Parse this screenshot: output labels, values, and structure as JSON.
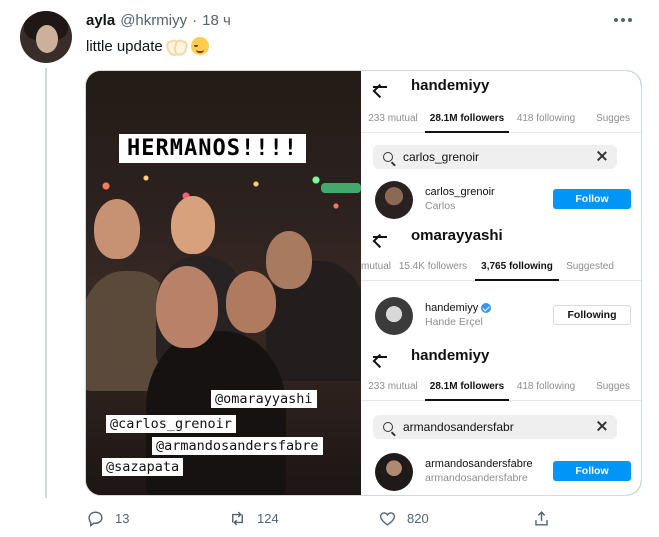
{
  "tweet": {
    "author_name": "ayla",
    "author_handle": "@hkrmiyy",
    "separator": "·",
    "time": "18 ч",
    "text": "little update",
    "emoji": [
      "open-hands-emoji",
      "relieved-face-emoji"
    ]
  },
  "story": {
    "caption": "HERMANOS!!!!",
    "tags": [
      "@omarayyashi",
      "@carlos_grenoir",
      "@armandosandersfabre",
      "@sazapata"
    ]
  },
  "panels": [
    {
      "title": "handemiyy",
      "tabs": [
        {
          "label": "233 mutual",
          "active": false
        },
        {
          "label": "28.1M followers",
          "active": true
        },
        {
          "label": "418 following",
          "active": false
        },
        {
          "label": "Sugges",
          "active": false
        }
      ],
      "search": "carlos_grenoir",
      "result": {
        "username": "carlos_grenoir",
        "name": "Carlos",
        "verified": false,
        "button": "Follow"
      }
    },
    {
      "title": "omarayyashi",
      "tabs": [
        {
          "label": "mutual",
          "active": false
        },
        {
          "label": "15.4K followers",
          "active": false
        },
        {
          "label": "3,765 following",
          "active": true
        },
        {
          "label": "Suggested",
          "active": false
        }
      ],
      "result": {
        "username": "handemiyy",
        "name": "Hande Erçel",
        "verified": true,
        "button": "Following"
      }
    },
    {
      "title": "handemiyy",
      "tabs": [
        {
          "label": "233 mutual",
          "active": false
        },
        {
          "label": "28.1M followers",
          "active": true
        },
        {
          "label": "418 following",
          "active": false
        },
        {
          "label": "Sugges",
          "active": false
        }
      ],
      "search": "armandosandersfabr",
      "result": {
        "username": "armandosandersfabre",
        "name": "armandosandersfabre",
        "verified": false,
        "button": "Follow"
      }
    }
  ],
  "actions": {
    "replies": "13",
    "retweets": "124",
    "likes": "820"
  },
  "colors": {
    "instagram_blue": "#0095f6",
    "secondary_text": "#536471"
  }
}
